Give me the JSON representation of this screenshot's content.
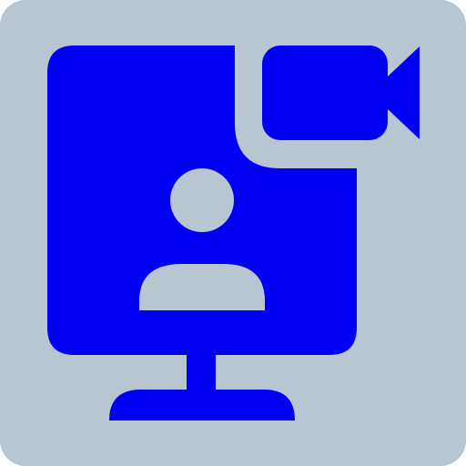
{
  "icon": {
    "name": "video-call-monitor-icon",
    "colors": {
      "tile_background": "#B8C6D2",
      "glyph": "#0000F5",
      "cutout": "#B8C6D2"
    },
    "parts": [
      "rounded-tile-background",
      "monitor-screen",
      "monitor-stand",
      "user-avatar",
      "video-camera-icon"
    ]
  }
}
